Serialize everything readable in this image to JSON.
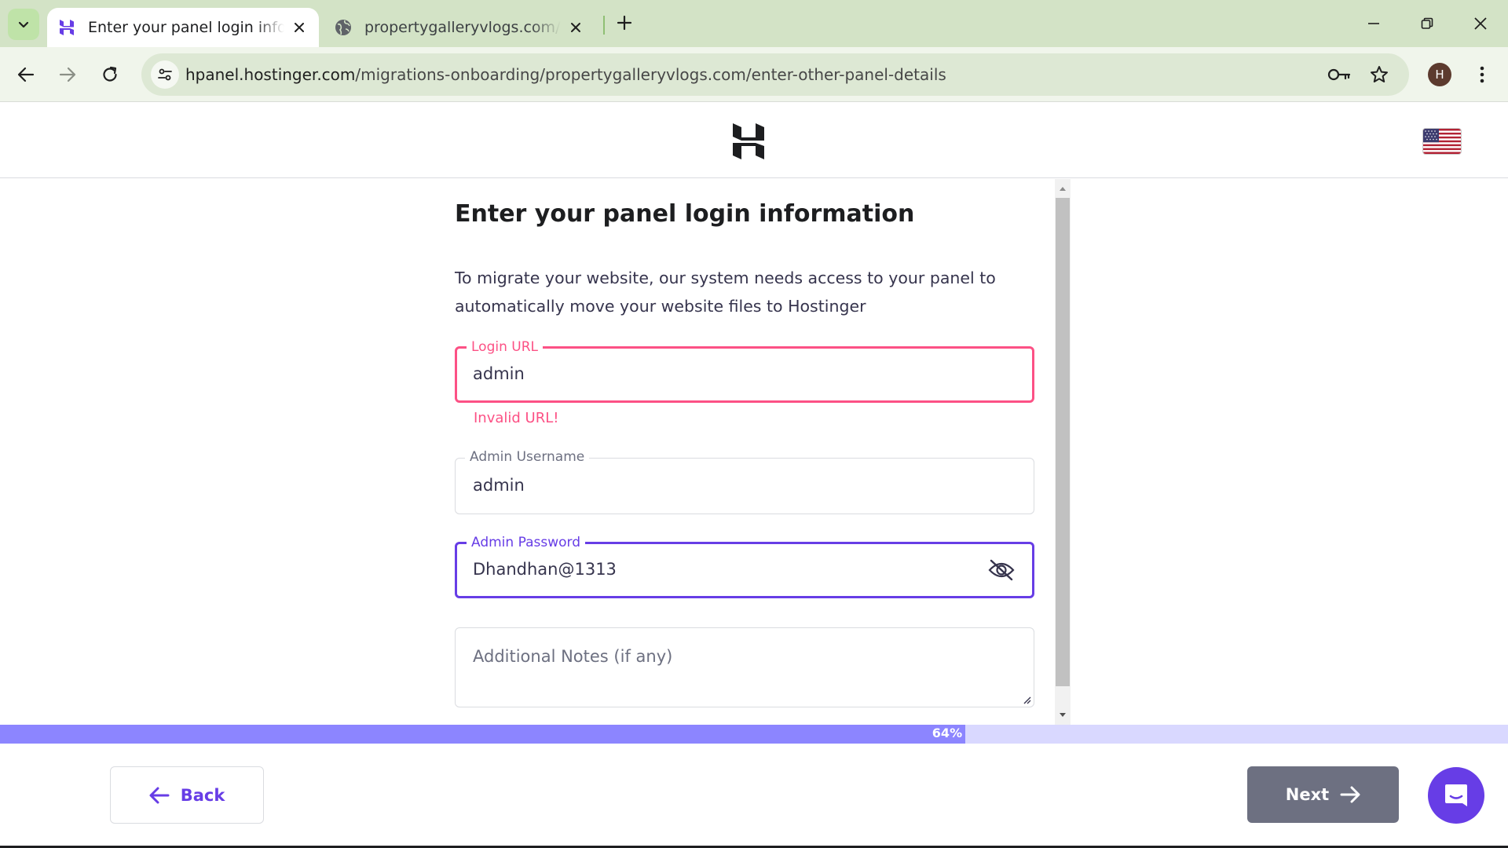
{
  "browser": {
    "tabs": [
      {
        "title": "Enter your panel login information | Hostinger",
        "active": true
      },
      {
        "title": "propertygalleryvlogs.com/landing",
        "active": false
      }
    ],
    "url_host": "hpanel.hostinger.com",
    "url_path": "/migrations-onboarding/propertygalleryvlogs.com/enter-other-panel-details",
    "profile_initial": "H"
  },
  "page": {
    "heading": "Enter your panel login information",
    "description": "To migrate your website, our system needs access to your panel to automatically move your website files to Hostinger",
    "fields": {
      "login_url": {
        "label": "Login URL",
        "value": "admin",
        "error": "Invalid URL!"
      },
      "username": {
        "label": "Admin Username",
        "value": "admin"
      },
      "password": {
        "label": "Admin Password",
        "value": "Dhandhan@1313"
      },
      "notes": {
        "placeholder": "Additional Notes (if any)"
      }
    },
    "progress": {
      "percent": 64,
      "label": "64%"
    },
    "back_label": "Back",
    "next_label": "Next"
  },
  "colors": {
    "brand": "#673de6",
    "error": "#fc5185",
    "progress_fill": "#8c85ff",
    "progress_track": "#d9d8ff",
    "next_disabled": "#6d7081"
  },
  "icons": [
    "chevron-down-icon",
    "hostinger-favicon",
    "globe-icon",
    "close-icon",
    "plus-icon",
    "minimize-icon",
    "restore-icon",
    "window-close-icon",
    "back-arrow-icon",
    "forward-arrow-icon",
    "reload-icon",
    "site-settings-icon",
    "key-icon",
    "star-icon",
    "more-vert-icon",
    "hostinger-logo",
    "us-flag-icon",
    "eye-off-icon",
    "arrow-left-icon",
    "arrow-right-icon",
    "chat-icon"
  ]
}
